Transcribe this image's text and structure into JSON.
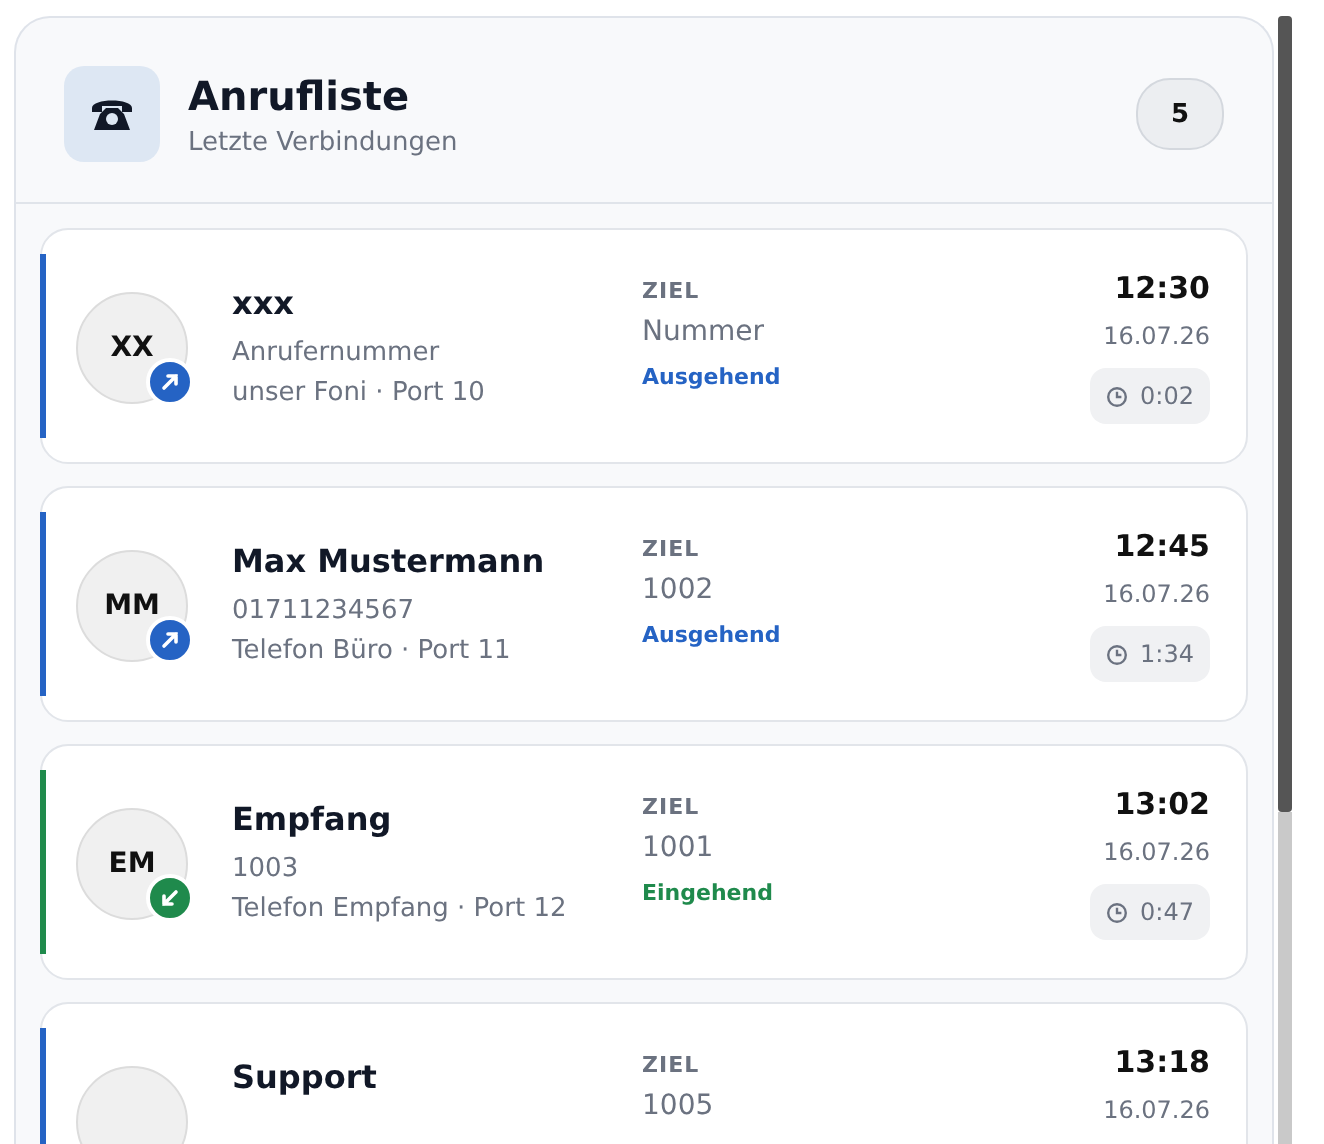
{
  "header": {
    "title": "Anrufliste",
    "subtitle": "Letzte Verbindungen",
    "count": "5"
  },
  "calls": [
    {
      "initials": "XX",
      "name": "xxx",
      "number": "Anrufernummer",
      "device": "unser Foni · Port 10",
      "target_label": "ZIEL",
      "target": "Nummer",
      "kind": "outgoing",
      "direction_label": "Ausgehend",
      "time": "12:30",
      "date": "16.07.26",
      "duration": "0:02"
    },
    {
      "initials": "MM",
      "name": "Max Mustermann",
      "number": "01711234567",
      "device": "Telefon Büro · Port 11",
      "target_label": "ZIEL",
      "target": "1002",
      "kind": "outgoing",
      "direction_label": "Ausgehend",
      "time": "12:45",
      "date": "16.07.26",
      "duration": "1:34"
    },
    {
      "initials": "EM",
      "name": "Empfang",
      "number": "1003",
      "device": "Telefon Empfang · Port 12",
      "target_label": "ZIEL",
      "target": "1001",
      "kind": "incoming",
      "direction_label": "Eingehend",
      "time": "13:02",
      "date": "16.07.26",
      "duration": "0:47"
    },
    {
      "name": "Support",
      "target_label": "ZIEL",
      "target": "1005",
      "kind": "outgoing",
      "time": "13:18",
      "date": "16.07.26"
    }
  ]
}
